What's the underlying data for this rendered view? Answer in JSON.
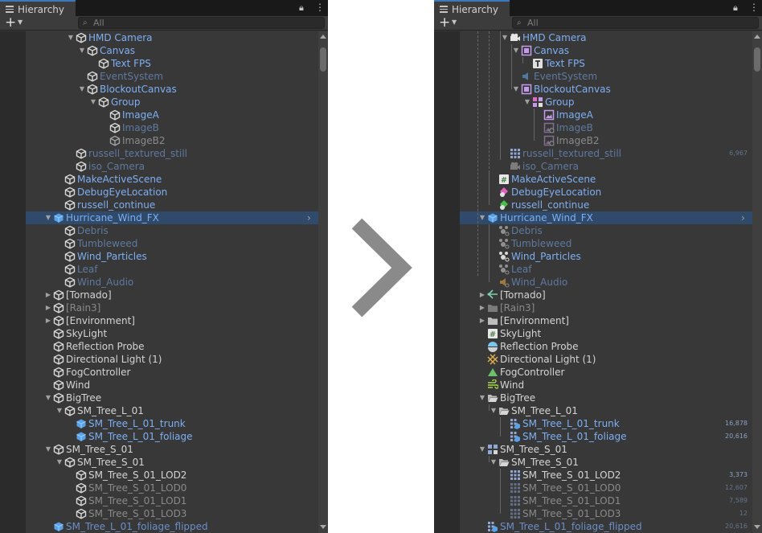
{
  "tab_label": "Hierarchy",
  "search_placeholder": "All",
  "left": {
    "rows": [
      {
        "label": "HMD Camera",
        "depth": 4,
        "arrow": "down",
        "icon": "cube",
        "style": "blue"
      },
      {
        "label": "Canvas",
        "depth": 5,
        "arrow": "down",
        "icon": "cube",
        "style": "blue"
      },
      {
        "label": "Text FPS",
        "depth": 6,
        "icon": "cube",
        "style": "blue"
      },
      {
        "label": "EventSystem",
        "depth": 5,
        "icon": "cube",
        "style": "pblue"
      },
      {
        "label": "BlockoutCanvas",
        "depth": 5,
        "arrow": "down",
        "icon": "cube",
        "style": "blue"
      },
      {
        "label": "Group",
        "depth": 6,
        "arrow": "down",
        "icon": "cube",
        "style": "blue"
      },
      {
        "label": "ImageA",
        "depth": 7,
        "icon": "cube",
        "style": "blue"
      },
      {
        "label": "ImageB",
        "depth": 7,
        "icon": "cube",
        "style": "pblue"
      },
      {
        "label": "ImageB2",
        "depth": 7,
        "icon": "cube-overlay",
        "style": "gray"
      },
      {
        "label": "russell_textured_still",
        "depth": 4,
        "icon": "cube",
        "style": "pblue"
      },
      {
        "label": "iso_Camera",
        "depth": 4,
        "icon": "cube",
        "style": "pblue"
      },
      {
        "label": "MakeActiveScene",
        "depth": 3,
        "icon": "cube",
        "style": "blue"
      },
      {
        "label": "DebugEyeLocation",
        "depth": 3,
        "icon": "cube",
        "style": "blue"
      },
      {
        "label": "russell_continue",
        "depth": 3,
        "icon": "cube",
        "style": "blue"
      },
      {
        "label": "Hurricane_Wind_FX",
        "depth": 2,
        "arrow": "down",
        "icon": "cube-blue",
        "style": "blue",
        "sel": true
      },
      {
        "label": "Debris",
        "depth": 3,
        "icon": "cube",
        "style": "pblue"
      },
      {
        "label": "Tumbleweed",
        "depth": 3,
        "icon": "cube",
        "style": "pblue"
      },
      {
        "label": "Wind_Particles",
        "depth": 3,
        "icon": "cube",
        "style": "blue"
      },
      {
        "label": "Leaf",
        "depth": 3,
        "icon": "cube",
        "style": "pblue"
      },
      {
        "label": "Wind_Audio",
        "depth": 3,
        "icon": "cube",
        "style": "pblue"
      },
      {
        "label": "[Tornado]",
        "depth": 2,
        "arrow": "right",
        "icon": "cube",
        "style": "white"
      },
      {
        "label": "[Rain3]",
        "depth": 2,
        "arrow": "right",
        "icon": "cube",
        "style": "gray"
      },
      {
        "label": "[Environment]",
        "depth": 2,
        "arrow": "right",
        "icon": "cube",
        "style": "white"
      },
      {
        "label": "SkyLight",
        "depth": 2,
        "icon": "cube",
        "style": "white"
      },
      {
        "label": "Reflection Probe",
        "depth": 2,
        "icon": "cube",
        "style": "white"
      },
      {
        "label": "Directional Light (1)",
        "depth": 2,
        "icon": "cube",
        "style": "white"
      },
      {
        "label": "FogController",
        "depth": 2,
        "icon": "cube",
        "style": "white"
      },
      {
        "label": "Wind",
        "depth": 2,
        "icon": "cube",
        "style": "white"
      },
      {
        "label": "BigTree",
        "depth": 2,
        "arrow": "down",
        "icon": "cube",
        "style": "white"
      },
      {
        "label": "SM_Tree_L_01",
        "depth": 3,
        "arrow": "down",
        "icon": "cube",
        "style": "white"
      },
      {
        "label": "SM_Tree_L_01_trunk",
        "depth": 4,
        "icon": "cube-blue",
        "style": "blue"
      },
      {
        "label": "SM_Tree_L_01_foliage",
        "depth": 4,
        "icon": "cube-blue",
        "style": "blue"
      },
      {
        "label": "SM_Tree_S_01",
        "depth": 2,
        "arrow": "down",
        "icon": "cube",
        "style": "white"
      },
      {
        "label": "SM_Tree_S_01",
        "depth": 3,
        "arrow": "down",
        "icon": "cube",
        "style": "white"
      },
      {
        "label": "SM_Tree_S_01_LOD2",
        "depth": 4,
        "icon": "cube",
        "style": "white"
      },
      {
        "label": "SM_Tree_S_01_LOD0",
        "depth": 4,
        "icon": "cube",
        "style": "gray"
      },
      {
        "label": "SM_Tree_S_01_LOD1",
        "depth": 4,
        "icon": "cube",
        "style": "gray"
      },
      {
        "label": "SM_Tree_S_01_LOD3",
        "depth": 4,
        "icon": "cube",
        "style": "gray"
      },
      {
        "label": "SM_Tree_L_01_foliage_flipped",
        "depth": 2,
        "icon": "cube-blue",
        "style": "dblue"
      }
    ]
  },
  "right": {
    "rows": [
      {
        "label": "HMD Camera",
        "depth": 4,
        "arrow": "down",
        "icon": "camera",
        "style": "blue"
      },
      {
        "label": "Canvas",
        "depth": 5,
        "arrow": "down",
        "icon": "canvas",
        "style": "blue"
      },
      {
        "label": "Text FPS",
        "depth": 6,
        "icon": "text",
        "style": "blue"
      },
      {
        "label": "EventSystem",
        "depth": 5,
        "icon": "eventsystem",
        "style": "pblue"
      },
      {
        "label": "BlockoutCanvas",
        "depth": 5,
        "arrow": "down",
        "icon": "canvas",
        "style": "blue"
      },
      {
        "label": "Group",
        "depth": 6,
        "arrow": "down",
        "icon": "group",
        "style": "blue"
      },
      {
        "label": "ImageA",
        "depth": 7,
        "icon": "image",
        "style": "blue"
      },
      {
        "label": "ImageB",
        "depth": 7,
        "icon": "image-dim",
        "style": "pblue"
      },
      {
        "label": "ImageB2",
        "depth": 7,
        "icon": "image-dim",
        "style": "gray"
      },
      {
        "label": "russell_textured_still",
        "depth": 4,
        "icon": "mesh-grid",
        "style": "pblue",
        "count": "6,967",
        "countDim": true
      },
      {
        "label": "iso_Camera",
        "depth": 4,
        "icon": "camera-dim",
        "style": "pblue"
      },
      {
        "label": "MakeActiveScene",
        "depth": 3,
        "icon": "script",
        "style": "blue"
      },
      {
        "label": "DebugEyeLocation",
        "depth": 3,
        "icon": "gizmo",
        "style": "blue"
      },
      {
        "label": "russell_continue",
        "depth": 3,
        "icon": "gizmo-green",
        "style": "blue"
      },
      {
        "label": "Hurricane_Wind_FX",
        "depth": 2,
        "arrow": "down",
        "icon": "cube-blue",
        "style": "blue",
        "sel": true
      },
      {
        "label": "Debris",
        "depth": 3,
        "icon": "particle-dim",
        "style": "pblue"
      },
      {
        "label": "Tumbleweed",
        "depth": 3,
        "icon": "particle-dim",
        "style": "pblue"
      },
      {
        "label": "Wind_Particles",
        "depth": 3,
        "icon": "particle",
        "style": "blue"
      },
      {
        "label": "Leaf",
        "depth": 3,
        "icon": "particle-dim",
        "style": "pblue"
      },
      {
        "label": "Wind_Audio",
        "depth": 3,
        "icon": "audio",
        "style": "pblue"
      },
      {
        "label": "[Tornado]",
        "depth": 2,
        "arrow": "right",
        "icon": "tornado",
        "style": "white"
      },
      {
        "label": "[Rain3]",
        "depth": 2,
        "arrow": "right",
        "icon": "folder-dim",
        "style": "gray"
      },
      {
        "label": "[Environment]",
        "depth": 2,
        "arrow": "right",
        "icon": "folder",
        "style": "white"
      },
      {
        "label": "SkyLight",
        "depth": 2,
        "icon": "script",
        "style": "white"
      },
      {
        "label": "Reflection Probe",
        "depth": 2,
        "icon": "probe",
        "style": "white"
      },
      {
        "label": "Directional Light (1)",
        "depth": 2,
        "icon": "light",
        "style": "white"
      },
      {
        "label": "FogController",
        "depth": 2,
        "icon": "fog",
        "style": "white"
      },
      {
        "label": "Wind",
        "depth": 2,
        "icon": "wind",
        "style": "white"
      },
      {
        "label": "BigTree",
        "depth": 2,
        "arrow": "down",
        "icon": "folder-open",
        "style": "white"
      },
      {
        "label": "SM_Tree_L_01",
        "depth": 3,
        "arrow": "down",
        "icon": "folder-open",
        "style": "white"
      },
      {
        "label": "SM_Tree_L_01_trunk",
        "depth": 4,
        "icon": "mesh-prefab",
        "style": "blue",
        "count": "16,878"
      },
      {
        "label": "SM_Tree_L_01_foliage",
        "depth": 4,
        "icon": "mesh-prefab",
        "style": "blue",
        "count": "20,616"
      },
      {
        "label": "SM_Tree_S_01",
        "depth": 2,
        "arrow": "down",
        "icon": "lodgroup",
        "style": "white"
      },
      {
        "label": "SM_Tree_S_01",
        "depth": 3,
        "arrow": "down",
        "icon": "folder-open",
        "style": "white"
      },
      {
        "label": "SM_Tree_S_01_LOD2",
        "depth": 4,
        "icon": "mesh-grid",
        "style": "white",
        "count": "3,373"
      },
      {
        "label": "SM_Tree_S_01_LOD0",
        "depth": 4,
        "icon": "mesh-grid-dim",
        "style": "gray",
        "count": "12,607",
        "countDim": true
      },
      {
        "label": "SM_Tree_S_01_LOD1",
        "depth": 4,
        "icon": "mesh-grid-dim",
        "style": "gray",
        "count": "7,589",
        "countDim": true
      },
      {
        "label": "SM_Tree_S_01_LOD3",
        "depth": 4,
        "icon": "mesh-grid-dim",
        "style": "gray",
        "count": "12",
        "countDim": true
      },
      {
        "label": "SM_Tree_L_01_foliage_flipped",
        "depth": 2,
        "icon": "mesh-prefab",
        "style": "dblue",
        "count": "20,616",
        "countDim": true
      }
    ]
  },
  "colors": {
    "panel_bg": "#383838",
    "selected_text": "#7eaff3",
    "accent": "#3a79bb",
    "transition_chevron": "#8a8a8a"
  },
  "transition": {
    "icon": "chevron-right-icon"
  }
}
